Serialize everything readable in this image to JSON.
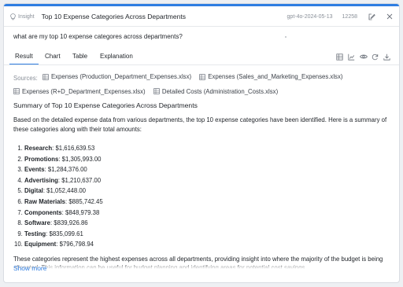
{
  "header": {
    "badge": "Insight",
    "title": "Top 10 Expense Categories Across Departments",
    "model": "gpt-4o-2024-05-13",
    "count": "12258"
  },
  "question": "what are my top 10 expense categores across departments?",
  "tabs": [
    "Result",
    "Chart",
    "Table",
    "Explanation"
  ],
  "sources": {
    "label": "Sources:",
    "items": [
      "Expenses (Production_Department_Expenses.xlsx)",
      "Expenses (Sales_and_Marketing_Expenses.xlsx)",
      "Expenses (R+D_Department_Expenses.xlsx)",
      "Detailed Costs (Administration_Costs.xlsx)"
    ]
  },
  "answer": {
    "heading": "Summary of Top 10 Expense Categories Across Departments",
    "intro": "Based on the detailed expense data from various departments, the top 10 expense categories have been identified. Here is a summary of these categories along with their total amounts:",
    "items": [
      {
        "name": "Research",
        "amount": ": $1,616,639.53"
      },
      {
        "name": "Promotions",
        "amount": ": $1,305,993.00"
      },
      {
        "name": "Events",
        "amount": ": $1,284,376.00"
      },
      {
        "name": "Advertising",
        "amount": ": $1,210,637.00"
      },
      {
        "name": "Digital",
        "amount": ": $1,052,448.00"
      },
      {
        "name": "Raw Materials",
        "amount": ": $885,742.45"
      },
      {
        "name": "Components",
        "amount": ": $848,979.38"
      },
      {
        "name": "Software",
        "amount": ": $839,926.86"
      },
      {
        "name": "Testing",
        "amount": ": $835,099.61"
      },
      {
        "name": "Equipment",
        "amount": ": $796,798.94"
      }
    ],
    "summary": "These categories represent the highest expenses across all departments, providing insight into where the majority of the budget is being allocated. This information can be useful for budget planning and identifying areas for potential cost savings."
  },
  "show_more": "Show more",
  "colors": {
    "accent": "#2f7de1",
    "muted": "#8a9099"
  }
}
